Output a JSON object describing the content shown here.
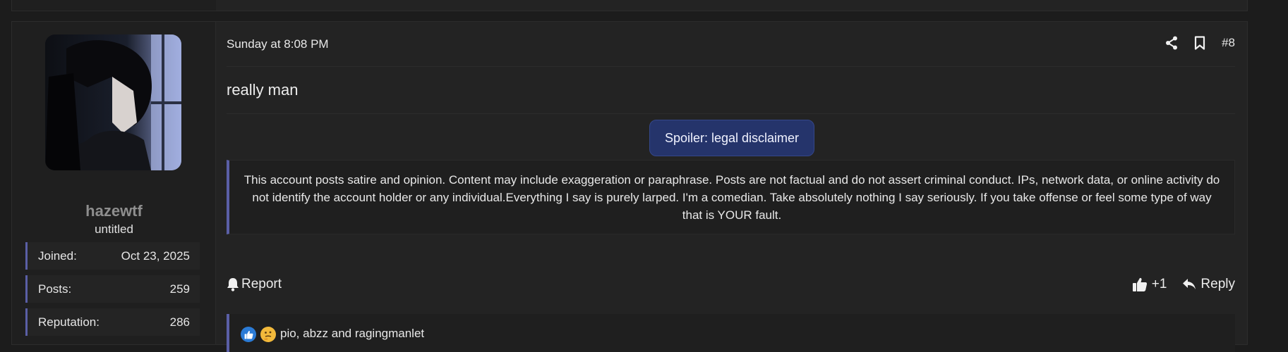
{
  "user": {
    "username": "hazewtf",
    "title": "untitled",
    "stats": [
      {
        "label": "Joined:",
        "value": "Oct 23, 2025"
      },
      {
        "label": "Posts:",
        "value": "259"
      },
      {
        "label": "Reputation:",
        "value": "286"
      }
    ]
  },
  "post": {
    "date": "Sunday at 8:08 PM",
    "number": "#8",
    "body": "really man",
    "spoiler_label": "Spoiler: legal disclaimer",
    "spoiler_text": "This account posts satire and opinion. Content may include exaggeration or paraphrase. Posts are not factual and do not assert criminal conduct. IPs, network data, or online activity do not identify the account holder or any individual.Everything I say is purely larped. I'm a comedian. Take absolutely nothing I say seriously. If you take offense or feel some type of way that is YOUR fault."
  },
  "actions": {
    "report": "Report",
    "like_count": "+1",
    "reply": "Reply"
  },
  "reactions": {
    "text": "pio, abzz and ragingmanlet",
    "icons": [
      "thumbs-up-icon",
      "thinking-face-icon"
    ]
  },
  "colors": {
    "accent": "#5a5fa6",
    "spoiler_button": "#25346b",
    "background": "#1c1c1c",
    "panel": "#232323"
  }
}
